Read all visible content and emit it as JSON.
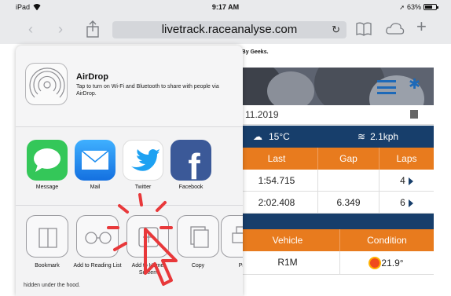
{
  "status_bar": {
    "device": "iPad",
    "time": "9:17 AM",
    "battery": "63%"
  },
  "toolbar": {
    "url": "livetrack.raceanalyse.com",
    "back": "‹",
    "forward": "›",
    "add": "+",
    "reload": "↻"
  },
  "page": {
    "tagline": "ks, By Geeks.",
    "date": "11.2019",
    "weather": {
      "temp": "15°C",
      "wind": "2.1kph"
    },
    "laps_table": {
      "headers": [
        "Last",
        "Gap",
        "Laps"
      ],
      "rows": [
        {
          "last": "1:54.715",
          "gap": "",
          "laps": "4"
        },
        {
          "last": "2:02.408",
          "gap": "6.349",
          "laps": "6"
        }
      ]
    },
    "vehicle_table": {
      "headers": [
        "Vehicle",
        "Condition"
      ],
      "rows": [
        {
          "vehicle": "R1M",
          "condition": "21.9°"
        }
      ]
    }
  },
  "share_sheet": {
    "airdrop": {
      "title": "AirDrop",
      "description": "Tap to turn on Wi-Fi and Bluetooth to share with people via AirDrop."
    },
    "apps": [
      {
        "label": "Message",
        "color": "#34c759"
      },
      {
        "label": "Mail",
        "color": "#1a8cf0"
      },
      {
        "label": "Twitter",
        "color": "#ffffff"
      },
      {
        "label": "Facebook",
        "color": "#3b5998"
      }
    ],
    "actions": [
      {
        "label": "Bookmark",
        "icon": "book-icon"
      },
      {
        "label": "Add to Reading List",
        "icon": "glasses-icon"
      },
      {
        "label": "Add to Home Screen",
        "icon": "plus-square-icon"
      },
      {
        "label": "Copy",
        "icon": "copy-icon"
      },
      {
        "label": "Pri",
        "icon": "print-icon"
      }
    ],
    "footer_text": "hidden under the hood."
  },
  "annotation": {
    "color": "#e8383a"
  }
}
